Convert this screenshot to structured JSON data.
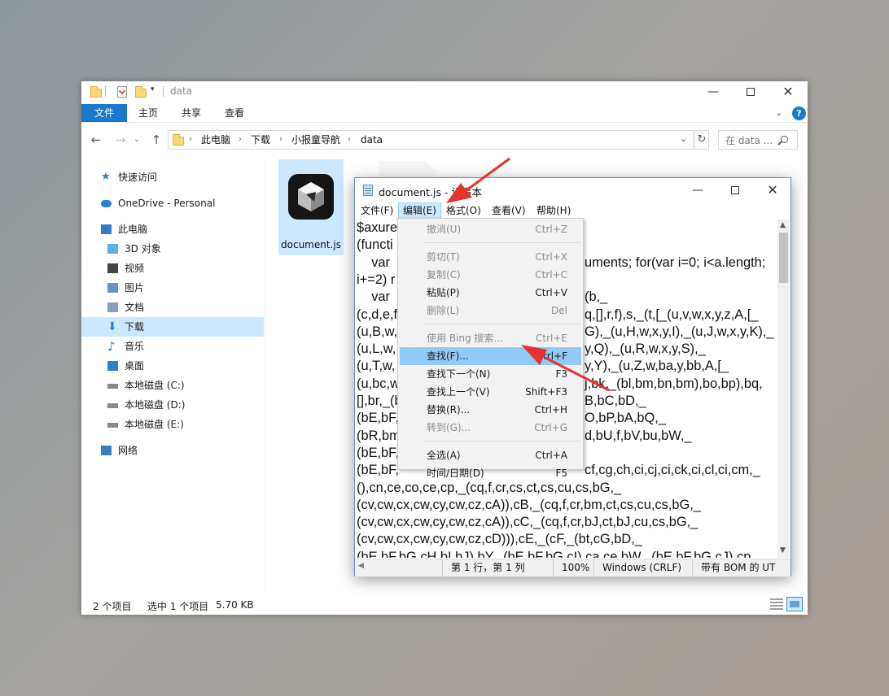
{
  "explorer": {
    "title": "data",
    "ribbon_tabs": [
      "文件",
      "主页",
      "共享",
      "查看"
    ],
    "breadcrumb": [
      "此电脑",
      "下载",
      "小报童导航",
      "data"
    ],
    "search_placeholder": "在 data ...",
    "nav_items": [
      {
        "label": "快速访问",
        "icon": "star-icon"
      },
      {
        "label": "OneDrive - Personal",
        "icon": "cloud-icon"
      },
      {
        "label": "此电脑",
        "icon": "computer-icon"
      },
      {
        "label": "3D 对象",
        "icon": "cube-icon"
      },
      {
        "label": "视频",
        "icon": "video-icon"
      },
      {
        "label": "图片",
        "icon": "picture-icon"
      },
      {
        "label": "文档",
        "icon": "document-icon"
      },
      {
        "label": "下载",
        "icon": "download-icon"
      },
      {
        "label": "音乐",
        "icon": "music-icon"
      },
      {
        "label": "桌面",
        "icon": "desktop-icon"
      },
      {
        "label": "本地磁盘 (C:)",
        "icon": "drive-icon"
      },
      {
        "label": "本地磁盘 (D:)",
        "icon": "drive-icon"
      },
      {
        "label": "本地磁盘 (E:)",
        "icon": "drive-icon"
      },
      {
        "label": "网络",
        "icon": "network-icon"
      }
    ],
    "selected_nav": "下载",
    "files": [
      {
        "name": "document.js",
        "selected": true
      }
    ],
    "status": {
      "count": "2 个项目",
      "selection": "选中 1 个项目",
      "size": "5.70 KB"
    }
  },
  "notepad": {
    "title": "document.js - 记事本",
    "menus": [
      "文件(F)",
      "编辑(E)",
      "格式(O)",
      "查看(V)",
      "帮助(H)"
    ],
    "active_menu": "编辑(E)",
    "lines_left": [
      "$axure",
      "(functi",
      "    var",
      "i+=2) r",
      "    var",
      "(c,d,e,f",
      "(u,B,w,",
      "(u,L,w,",
      "(u,T,w,",
      "(u,bc,w",
      "[],br,_(b",
      "(bE,bF,",
      "(bR,bm",
      "(bE,bF,",
      "(bE,bF,",
      "(),cn,ce,co,ce,cp,_(cq,f,cr,cs,ct,cs,cu,cs,bG,_",
      "(cv,cw,cx,cw,cy,cw,cz,cA)),cB,_(cq,f,cr,bm,ct,cs,cu,cs,bG,_",
      "(cv,cw,cx,cw,cy,cw,cz,cA)),cC,_(cq,f,cr,bJ,ct,bJ,cu,cs,bG,_",
      "(cv,cw,cx,cw,cy,cw,cz,cD))),cE,_(cF,_(bt,cG,bD,_",
      "(bE,bF,bG,cH,bI,bJ),bY,_(bE,bF,bG,cI),ca,ce,bW,_(bE,bF,bG,cJ),cp,"
    ],
    "lines_right": [
      "",
      "",
      "uments; for(var i=0; i<a.length;",
      "",
      "(b,_",
      "q,[],r,f),s,_(t,[_(u,v,w,x,y,z,A,[_",
      "G),_(u,H,w,x,y,I),_(u,J,w,x,y,K),_",
      "y,Q),_(u,R,w,x,y,S),_",
      "y,Y),_(u,Z,w,ba,y,bb,A,[_",
      "j,bk,_(bl,bm,bn,bm),bo,bp),bq,",
      "B,bC,bD,_",
      "O,bP,bA,bQ,_",
      "d,bU,f,bV,bu,bW,_",
      "",
      "cf,cg,ch,ci,cj,ci,ck,ci,cl,ci,cm,_"
    ],
    "status": {
      "position": "第 1 行，第 1 列",
      "zoom": "100%",
      "eol": "Windows (CRLF)",
      "encoding": "带有 BOM 的 UT"
    }
  },
  "edit_menu": {
    "items": [
      {
        "label": "撤消(U)",
        "shortcut": "Ctrl+Z",
        "disabled": true
      },
      {
        "sep": true
      },
      {
        "label": "剪切(T)",
        "shortcut": "Ctrl+X",
        "disabled": true
      },
      {
        "label": "复制(C)",
        "shortcut": "Ctrl+C",
        "disabled": true
      },
      {
        "label": "粘贴(P)",
        "shortcut": "Ctrl+V",
        "disabled": false
      },
      {
        "label": "删除(L)",
        "shortcut": "Del",
        "disabled": true
      },
      {
        "sep": true
      },
      {
        "label": "使用 Bing 搜索...",
        "shortcut": "Ctrl+E",
        "disabled": true
      },
      {
        "label": "查找(F)...",
        "shortcut": "Ctrl+F",
        "disabled": false,
        "highlighted": true
      },
      {
        "label": "查找下一个(N)",
        "shortcut": "F3",
        "disabled": false
      },
      {
        "label": "查找上一个(V)",
        "shortcut": "Shift+F3",
        "disabled": false
      },
      {
        "label": "替换(R)...",
        "shortcut": "Ctrl+H",
        "disabled": false
      },
      {
        "label": "转到(G)...",
        "shortcut": "Ctrl+G",
        "disabled": true
      },
      {
        "sep": true
      },
      {
        "label": "全选(A)",
        "shortcut": "Ctrl+A",
        "disabled": false
      },
      {
        "label": "时间/日期(D)",
        "shortcut": "F5",
        "disabled": false
      }
    ]
  },
  "colors": {
    "accent": "#1979ca",
    "selection": "#cce8ff",
    "menu_highlight": "#91c9f7",
    "annotation_arrow": "#e8322d"
  }
}
